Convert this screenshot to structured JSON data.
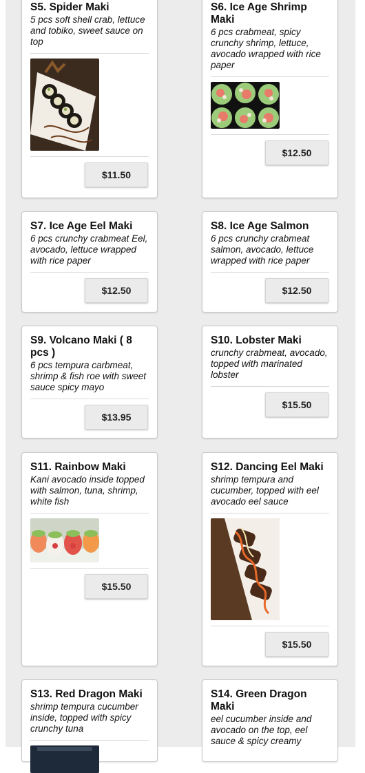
{
  "items": [
    {
      "code_title": "S5. Spider Maki",
      "description": "5 pcs soft shell crab, lettuce and tobiko, sweet sauce on top",
      "price": "$11.50",
      "image": "spider-maki-photo"
    },
    {
      "code_title": "S6. Ice Age Shrimp Maki",
      "description": "6 pcs crabmeat, spicy crunchy shrimp, lettuce, avocado wrapped with rice paper",
      "price": "$12.50",
      "image": "ice-age-shrimp-photo"
    },
    {
      "code_title": "S7. Ice Age Eel Maki",
      "description": "6 pcs crunchy crabmeat Eel, avocado, lettuce wrapped with rice paper",
      "price": "$12.50"
    },
    {
      "code_title": "S8. Ice Age Salmon",
      "description": "6 pcs crunchy crabmeat salmon, avocado, lettuce wrapped with rice paper",
      "price": "$12.50"
    },
    {
      "code_title": "S9. Volcano Maki ( 8 pcs )",
      "description": "6 pcs tempura carbmeat, shrimp & fish roe with sweet sauce spicy mayo",
      "price": "$13.95"
    },
    {
      "code_title": "S10. Lobster Maki",
      "description": "crunchy crabmeat, avocado, topped with marinated lobster",
      "price": "$15.50"
    },
    {
      "code_title": "S11. Rainbow Maki",
      "description": "Kani avocado inside topped with salmon, tuna, shrimp, white fish",
      "price": "$15.50",
      "image": "rainbow-maki-photo"
    },
    {
      "code_title": "S12. Dancing Eel Maki",
      "description": "shrimp tempura and cucumber, topped with eel avocado eel sauce",
      "price": "$15.50",
      "image": "dancing-eel-photo"
    },
    {
      "code_title": "S13. Red Dragon Maki",
      "description": "shrimp tempura cucumber inside, topped with spicy crunchy tuna",
      "image": "red-dragon-photo"
    },
    {
      "code_title": "S14. Green Dragon Maki",
      "description": "eel cucumber inside and avocado on the top, eel sauce & spicy creamy"
    }
  ]
}
